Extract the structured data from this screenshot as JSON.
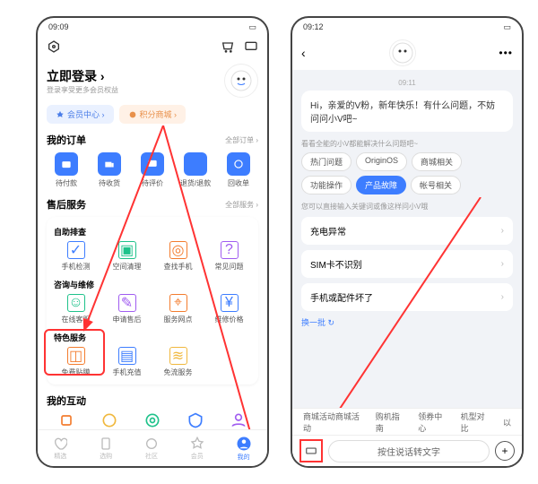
{
  "p1": {
    "time": "09:09",
    "login_title": "立即登录 ›",
    "login_sub": "登录享受更多会员权益",
    "pills": {
      "member": "会员中心 ›",
      "points": "积分商城 ›"
    },
    "orders": {
      "title": "我的订单",
      "link": "全部订单 ›",
      "items": [
        "待付款",
        "待收货",
        "待评价",
        "退货/退款",
        "回收单"
      ],
      "colors": [
        "#3d7dff",
        "#3d7dff",
        "#3d7dff",
        "#3d7dff",
        "#3d7dff"
      ]
    },
    "after": {
      "title": "售后服务",
      "link": "全部服务 ›"
    },
    "selfcheck": {
      "title": "自助排查",
      "items": [
        "手机检测",
        "空间清理",
        "查找手机",
        "常见问题"
      ],
      "colors": [
        "#3d7dff",
        "#1fc28b",
        "#f37c2e",
        "#a05cf0"
      ]
    },
    "consult": {
      "title": "咨询与维修",
      "items": [
        "在线客服",
        "申请售后",
        "服务网点",
        "维修价格"
      ],
      "colors": [
        "#1fc28b",
        "#a05cf0",
        "#f37c2e",
        "#3d7dff"
      ]
    },
    "special": {
      "title": "特色服务",
      "items": [
        "免费贴膜",
        "手机充值",
        "免流服务"
      ],
      "colors": [
        "#f37c2e",
        "#3d7dff",
        "#f0b83d"
      ]
    },
    "interact": {
      "title": "我的互动"
    },
    "tabs": [
      "精选",
      "选购",
      "社区",
      "会员",
      "我的"
    ]
  },
  "p2": {
    "time": "09:12",
    "ts": "09:11",
    "greeting": "Hi，亲爱的V粉，新年快乐！有什么问题，不妨问问小V吧~",
    "hint1": "看看全能的小V都能解决什么问题吧~",
    "chips": [
      "热门问题",
      "OriginOS",
      "商城相关",
      "功能操作",
      "产品故障",
      "帐号相关"
    ],
    "chip_active": 4,
    "hint2": "您可以直接输入关键词或像这样问小V哦",
    "rows": [
      "充电异常",
      "SIM卡不识别",
      "手机或配件坏了"
    ],
    "refresh": "换一批 ↻",
    "scrolltabs": [
      "商城活动",
      "购机指南",
      "领券中心",
      "机型对比",
      "以"
    ],
    "voice": "按住说话转文字"
  }
}
